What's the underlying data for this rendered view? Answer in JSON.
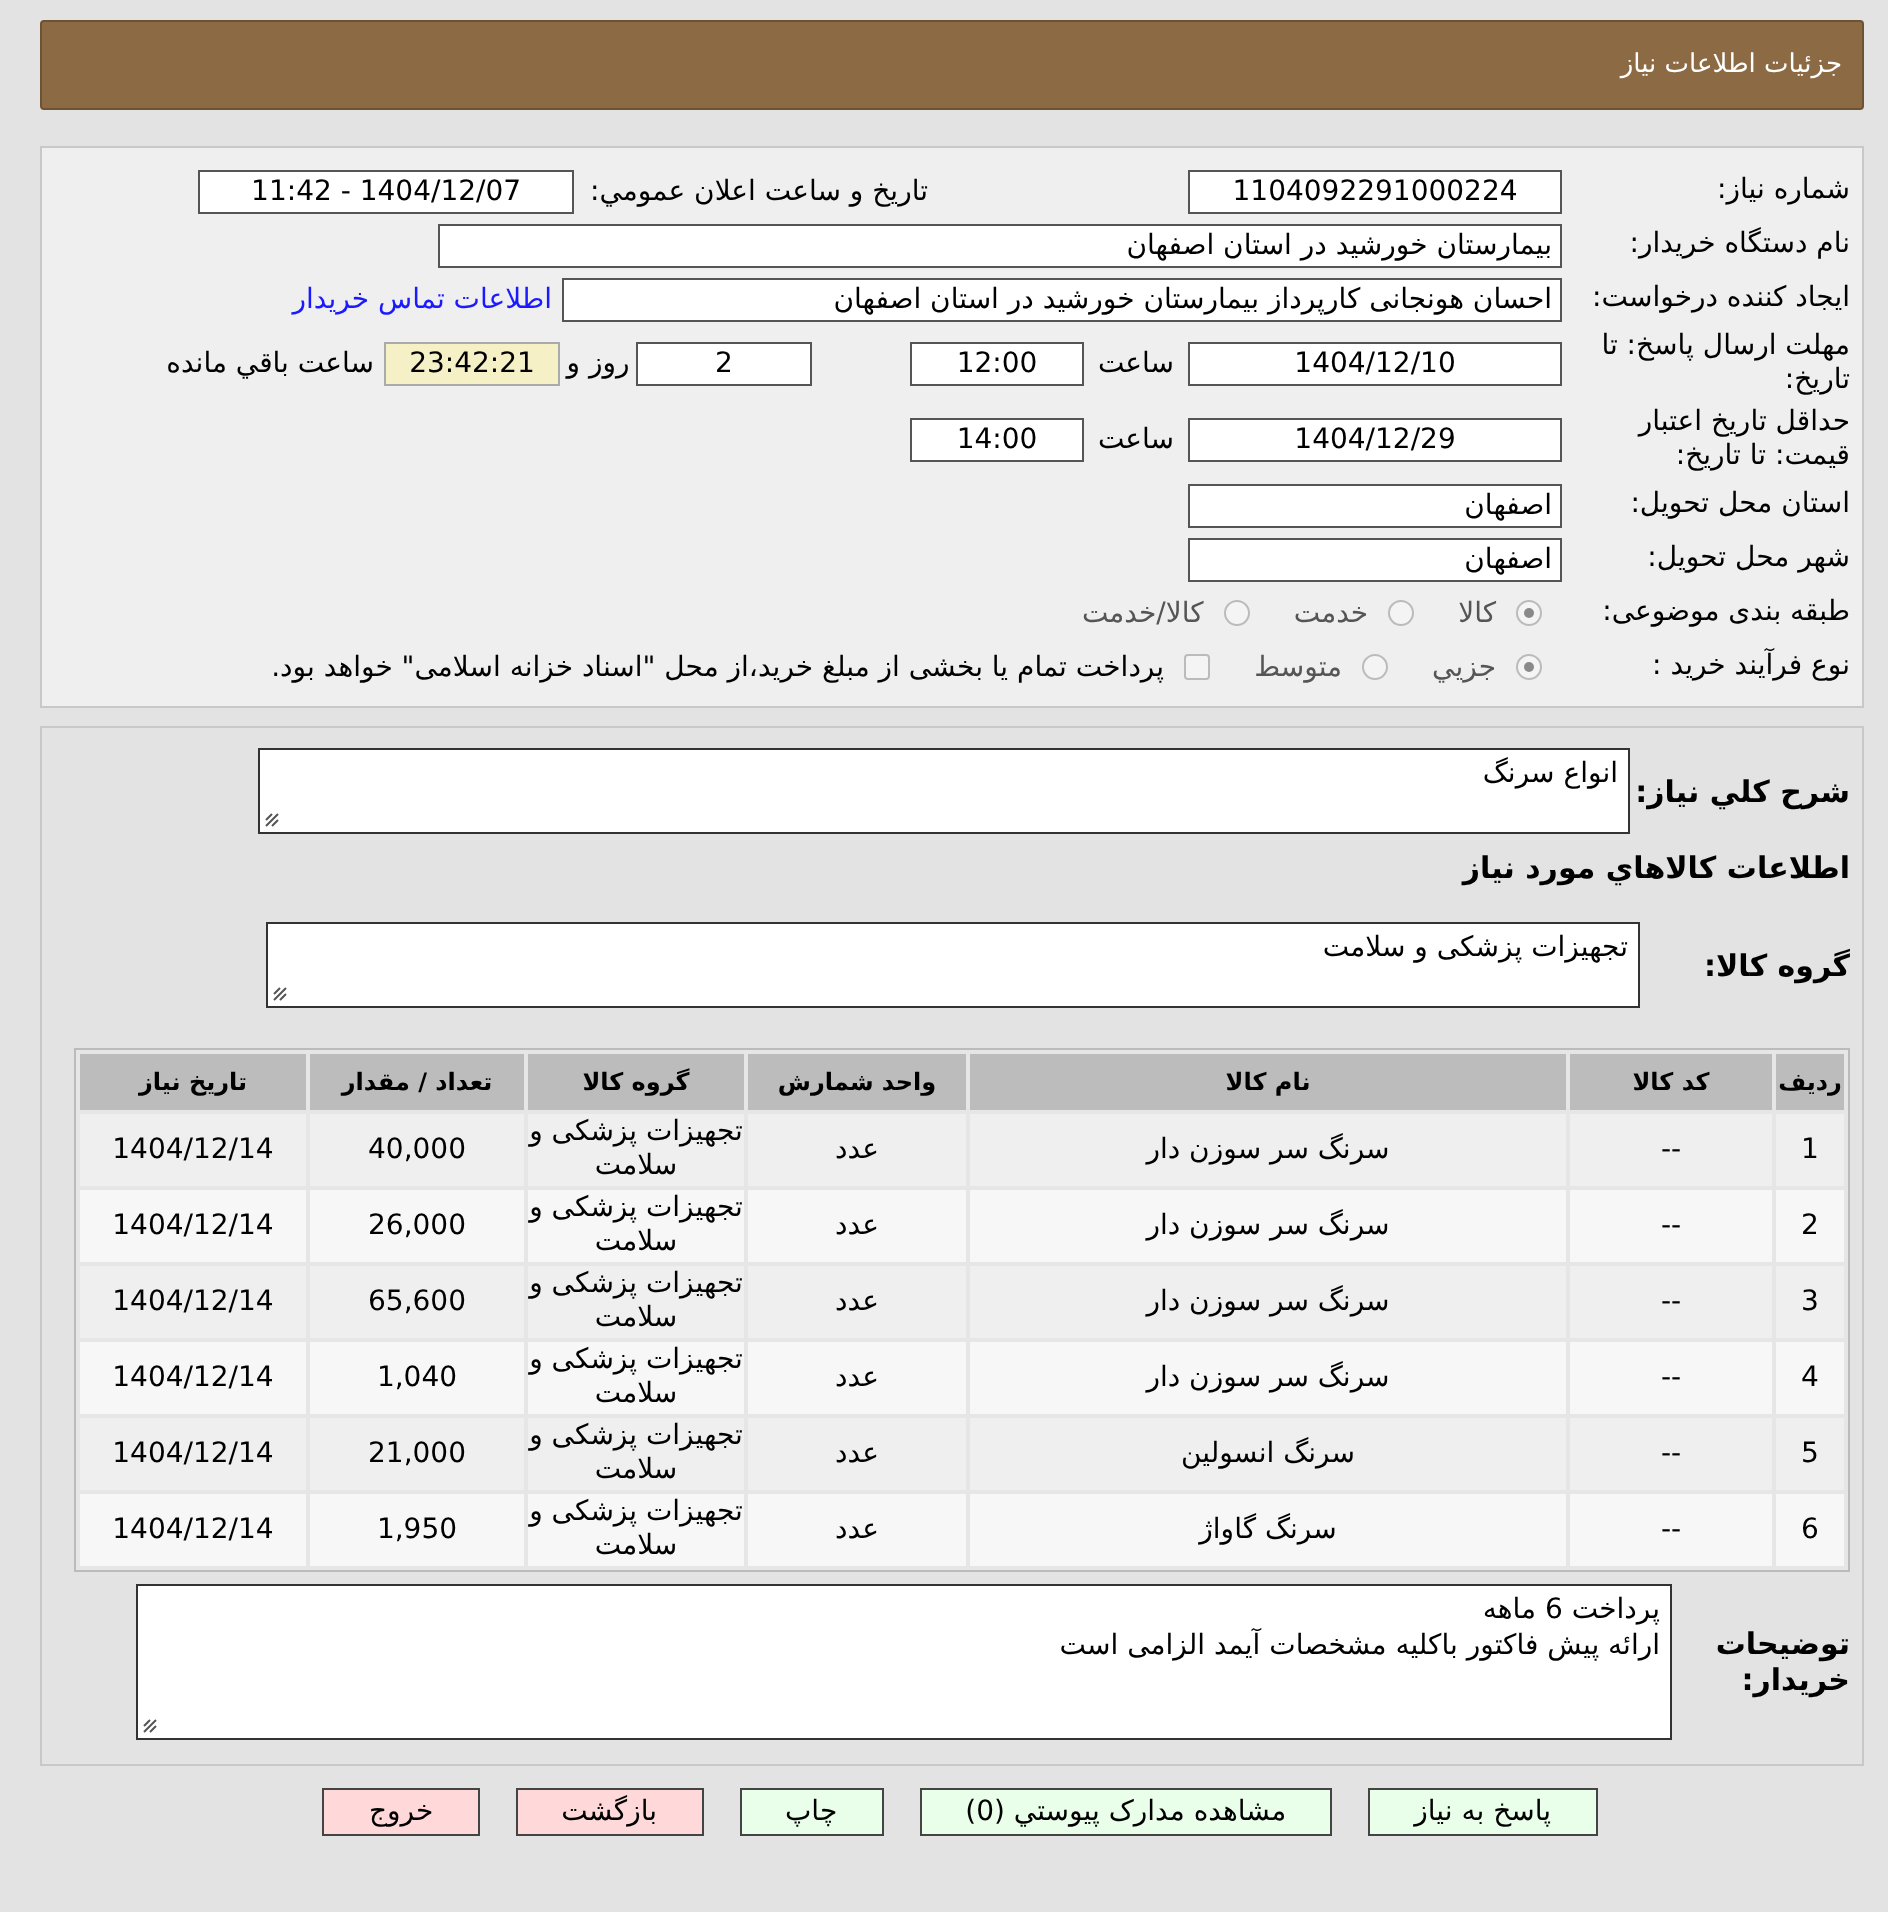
{
  "header": {
    "title": "جزئیات اطلاعات نیاز"
  },
  "details": {
    "need_number": {
      "label": "شماره نیاز:",
      "value": "1104092291000224"
    },
    "announce": {
      "label": "تاریخ و ساعت اعلان عمومي:",
      "value": "1404/12/07 - 11:42"
    },
    "buyer_org": {
      "label": "نام دستگاه خریدار:",
      "value": "بیمارستان خورشید در استان اصفهان"
    },
    "requester": {
      "label": "ایجاد کننده درخواست:",
      "value": "احسان هونجانی کارپرداز بیمارستان خورشید در استان اصفهان",
      "contact_link": "اطلاعات تماس خریدار"
    },
    "deadline": {
      "label": "مهلت ارسال پاسخ: تا تاریخ:",
      "date": "1404/12/10",
      "time_label": "ساعت",
      "time": "12:00",
      "days": "2",
      "days_label": "روز و",
      "countdown": "23:42:21",
      "countdown_label": "ساعت باقي مانده"
    },
    "validity": {
      "label": "حداقل تاریخ اعتبار قیمت: تا تاریخ:",
      "date": "1404/12/29",
      "time_label": "ساعت",
      "time": "14:00"
    },
    "province": {
      "label": "استان محل تحویل:",
      "value": "اصفهان"
    },
    "city": {
      "label": "شهر محل تحویل:",
      "value": "اصفهان"
    },
    "category": {
      "label": "طبقه بندی موضوعی:",
      "disabled": true,
      "options": [
        {
          "label": "کالا",
          "selected": true
        },
        {
          "label": "خدمت",
          "selected": false
        },
        {
          "label": "کالا/خدمت",
          "selected": false
        }
      ]
    },
    "process": {
      "label": "نوع فرآیند خرید :",
      "disabled": true,
      "options": [
        {
          "label": "جزيي",
          "selected": true
        },
        {
          "label": "متوسط",
          "selected": false
        }
      ],
      "checkbox": {
        "checked": false,
        "label": "پرداخت تمام یا بخشی از مبلغ خرید،از محل \"اسناد خزانه اسلامی\" خواهد بود."
      }
    }
  },
  "description": {
    "label": "شرح کلي نیاز:",
    "value": "انواع سرنگ"
  },
  "items_heading": "اطلاعات کالاهاي مورد نیاز",
  "goods_group": {
    "label": "گروه کالا:",
    "value": "تجهیزات پزشکی و سلامت"
  },
  "table": {
    "columns": [
      "ردیف",
      "کد کالا",
      "نام کالا",
      "واحد شمارش",
      "گروه کالا",
      "تعداد / مقدار",
      "تاریخ نیاز"
    ],
    "rows": [
      [
        "1",
        "--",
        "سرنگ سر سوزن دار",
        "عدد",
        "تجهیزات پزشکی و سلامت",
        "40,000",
        "1404/12/14"
      ],
      [
        "2",
        "--",
        "سرنگ سر سوزن دار",
        "عدد",
        "تجهیزات پزشکی و سلامت",
        "26,000",
        "1404/12/14"
      ],
      [
        "3",
        "--",
        "سرنگ سر سوزن دار",
        "عدد",
        "تجهیزات پزشکی و سلامت",
        "65,600",
        "1404/12/14"
      ],
      [
        "4",
        "--",
        "سرنگ سر سوزن دار",
        "عدد",
        "تجهیزات پزشکی و سلامت",
        "1,040",
        "1404/12/14"
      ],
      [
        "5",
        "--",
        "سرنگ انسولین",
        "عدد",
        "تجهیزات پزشکی و سلامت",
        "21,000",
        "1404/12/14"
      ],
      [
        "6",
        "--",
        "سرنگ گاواژ",
        "عدد",
        "تجهیزات پزشکی و سلامت",
        "1,950",
        "1404/12/14"
      ]
    ]
  },
  "buyer_notes": {
    "label": "توضیحات خریدار:",
    "lines": [
      "پرداخت 6 ماهه",
      "ارائه پیش فاکتور باکلیه مشخصات آیمد الزامی است"
    ]
  },
  "buttons": [
    {
      "label": "پاسخ به نیاز",
      "kind": "normal"
    },
    {
      "label": "مشاهده مدارک پیوستي (0)",
      "kind": "normal"
    },
    {
      "label": "چاپ",
      "kind": "normal"
    },
    {
      "label": "بازگشت",
      "kind": "danger"
    },
    {
      "label": "خروج",
      "kind": "danger"
    }
  ]
}
